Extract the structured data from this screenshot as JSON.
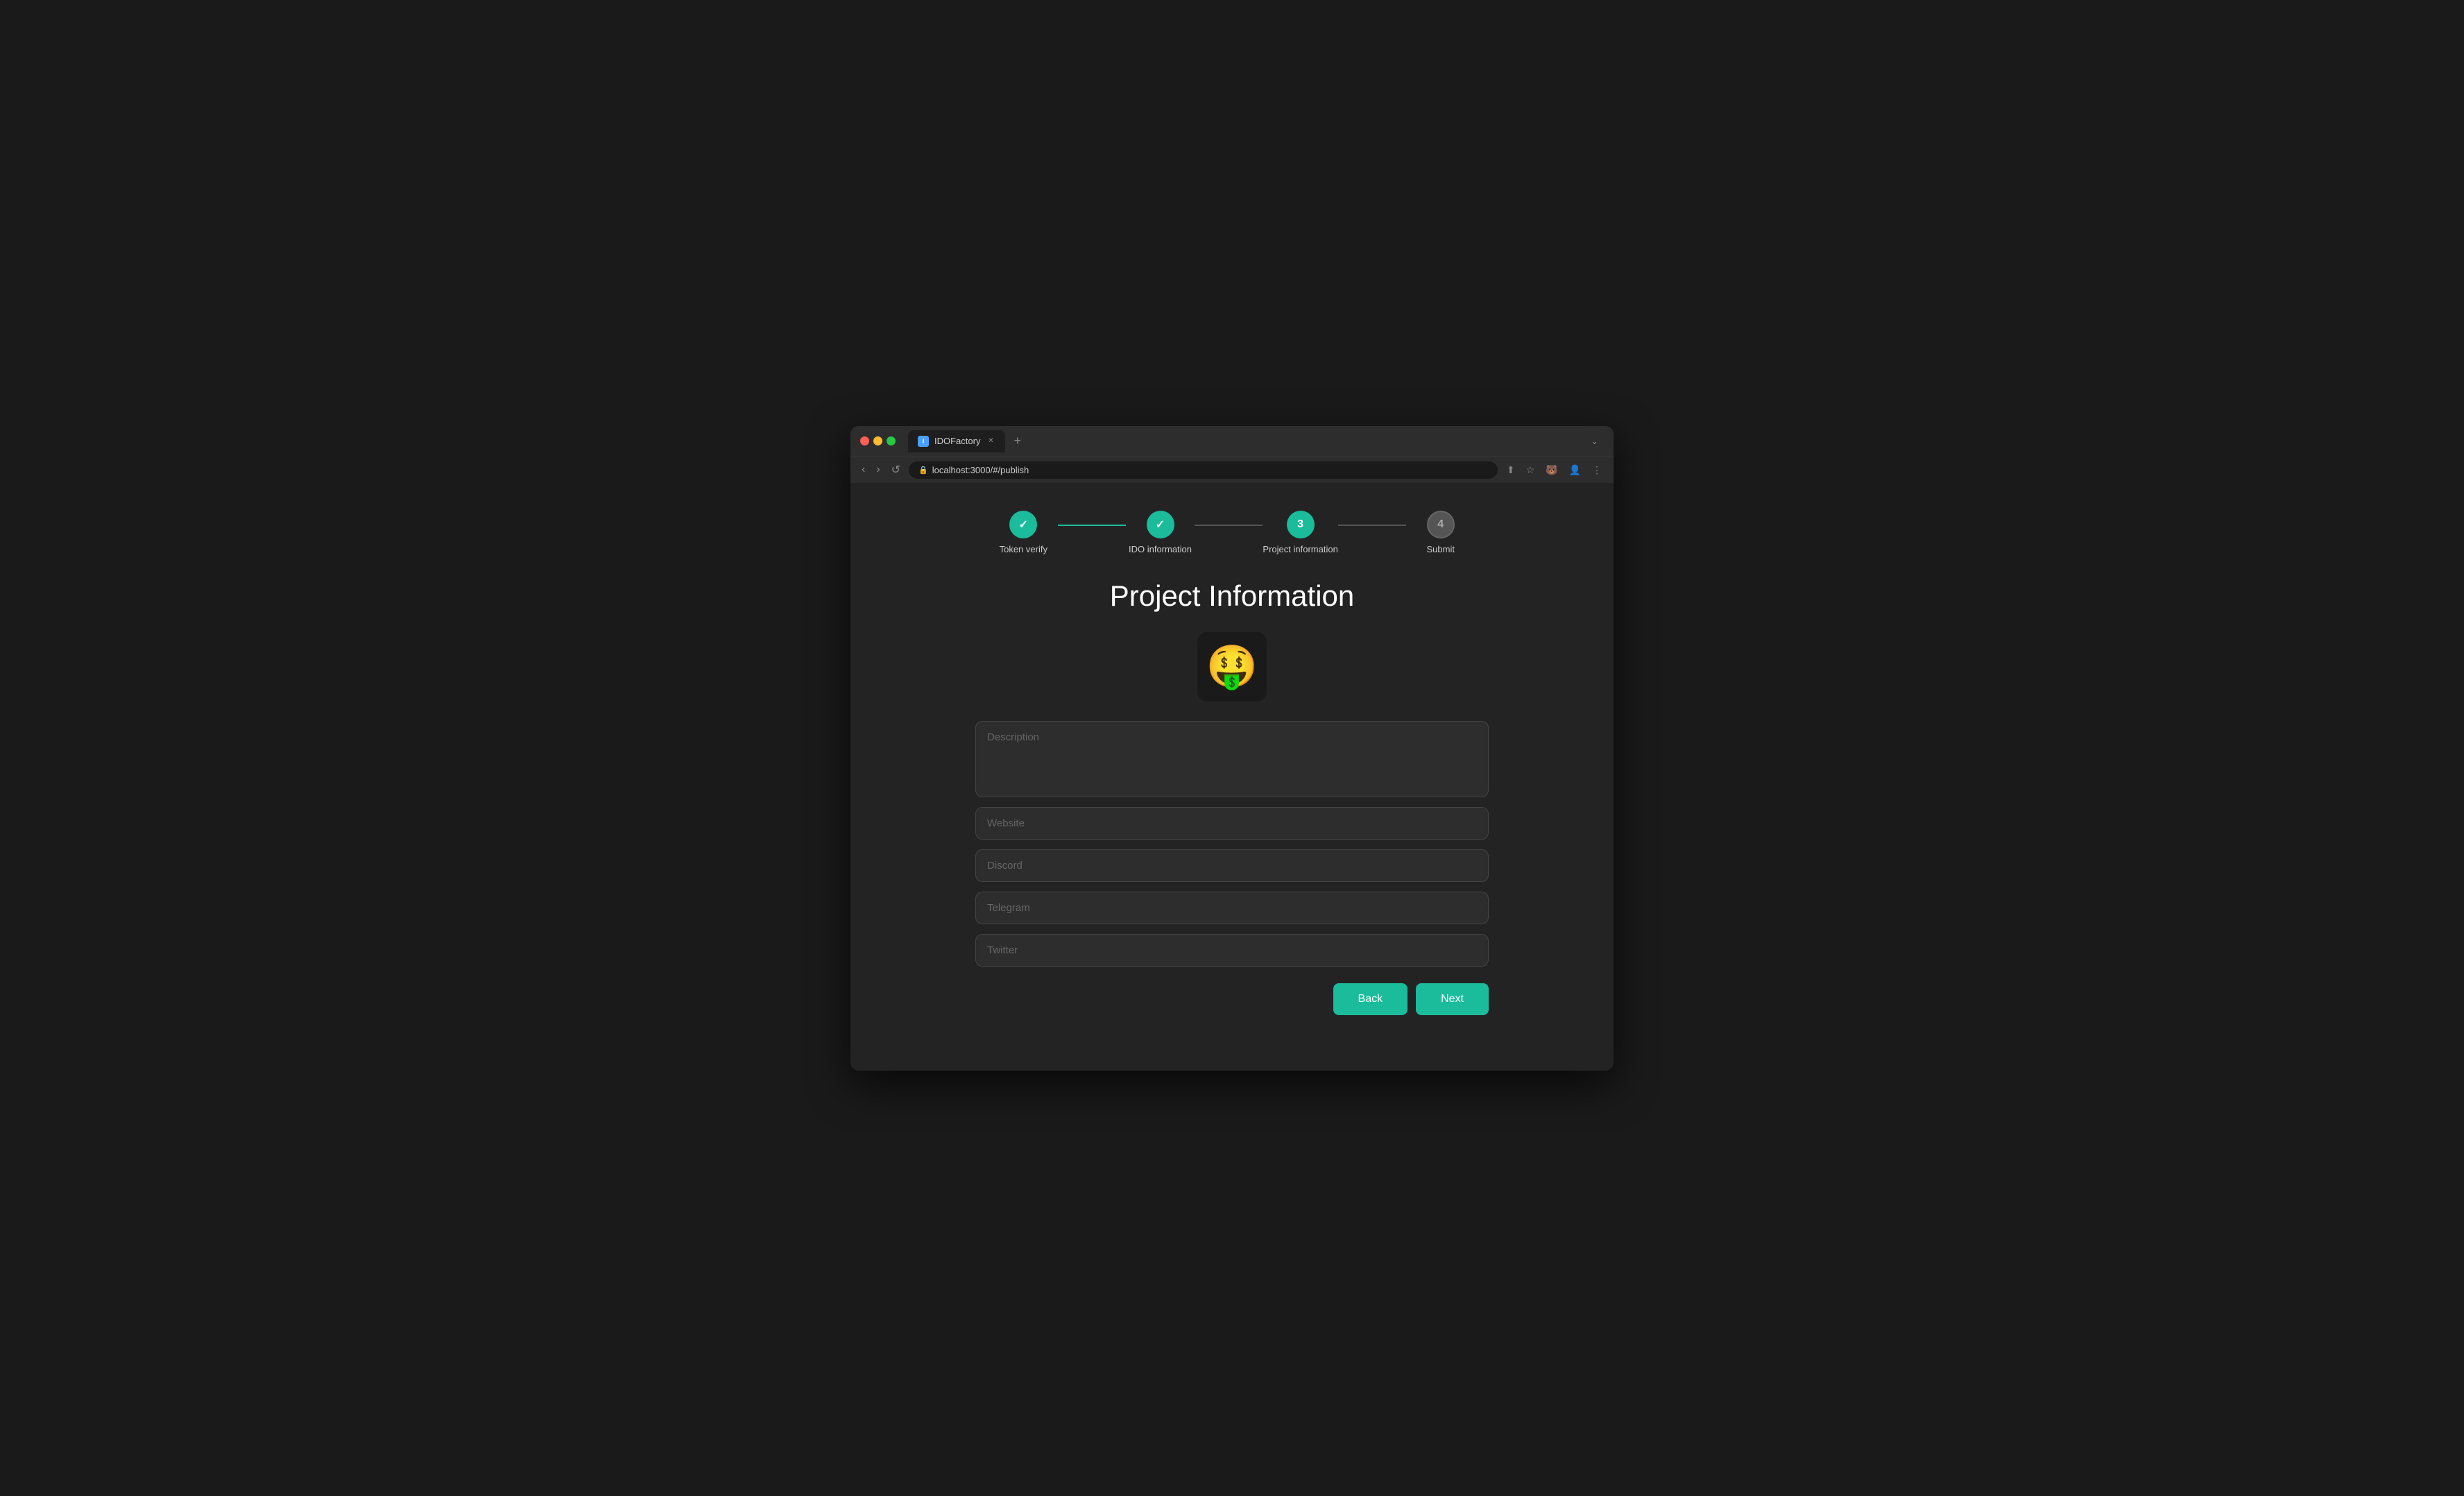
{
  "browser": {
    "tab_title": "IDOFactory",
    "url": "localhost:3000/#/publish",
    "new_tab_label": "+",
    "nav_back": "‹",
    "nav_forward": "›",
    "nav_refresh": "↺"
  },
  "stepper": {
    "steps": [
      {
        "id": "token-verify",
        "label": "Token verify",
        "state": "completed",
        "number": ""
      },
      {
        "id": "ido-information",
        "label": "IDO information",
        "state": "completed",
        "number": ""
      },
      {
        "id": "project-information",
        "label": "Project information",
        "state": "active",
        "number": "3"
      },
      {
        "id": "submit",
        "label": "Submit",
        "state": "inactive",
        "number": "4"
      }
    ]
  },
  "page": {
    "title": "Project Information"
  },
  "form": {
    "description_placeholder": "Description",
    "website_placeholder": "Website",
    "discord_placeholder": "Discord",
    "telegram_placeholder": "Telegram",
    "twitter_placeholder": "Twitter"
  },
  "buttons": {
    "back_label": "Back",
    "next_label": "Next"
  },
  "avatar_emoji": "🤑"
}
